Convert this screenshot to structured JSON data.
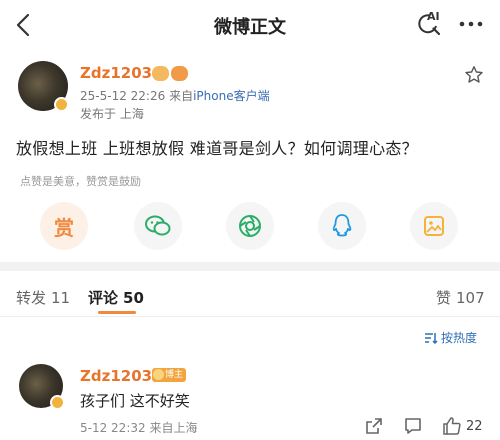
{
  "header": {
    "title": "微博正文",
    "ai_label": "AI",
    "back_icon": "chevron-left-icon",
    "ai_icon": "ai-search-icon",
    "more_icon": "more-dots-icon"
  },
  "post": {
    "username": "Zdz1203",
    "time": "25-5-12 22:26",
    "source_prefix": "来自",
    "client": "iPhone客户端",
    "location": "发布于 上海",
    "text": "放假想上班 上班想放假 难道哥是剑人？如何调理心态？",
    "like_hint": "点赞是美意，赞赏是鼓励"
  },
  "share_actions": [
    {
      "label": "赏",
      "icon": "reward-icon"
    },
    {
      "icon": "wechat-icon"
    },
    {
      "icon": "moments-icon"
    },
    {
      "icon": "qq-icon"
    },
    {
      "icon": "save-image-icon"
    }
  ],
  "tabs": {
    "repost_label": "转发",
    "repost_count": "11",
    "comment_label": "评论",
    "comment_count": "50",
    "like_label": "赞",
    "like_count": "107"
  },
  "sort": {
    "label": "按热度"
  },
  "comment": {
    "username": "Zdz1203",
    "author_badge": "博主",
    "text": "孩子们 这不好笑",
    "meta": "5-12 22:32 来自上海",
    "likes": "22"
  },
  "colors": {
    "accent": "#f08a3e",
    "username": "#e8742c",
    "link": "#2f6fb3",
    "wechat": "#2aae67",
    "qq": "#1e9ae0",
    "save": "#f3b23b"
  }
}
